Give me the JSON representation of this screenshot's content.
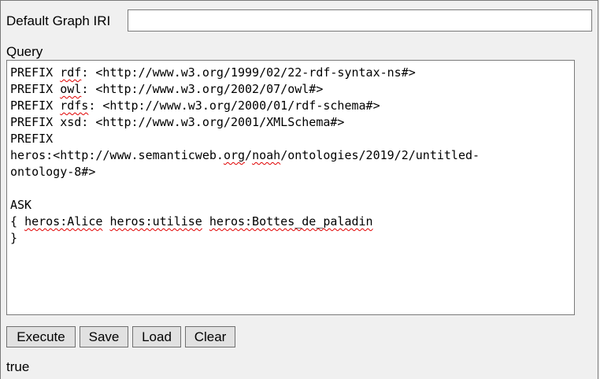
{
  "graph": {
    "label": "Default Graph IRI",
    "value": ""
  },
  "query": {
    "label": "Query",
    "lines": {
      "l1_pre": "PREFIX ",
      "l1_ns": "rdf",
      "l1_post": ": <http://www.w3.org/1999/02/22-rdf-syntax-ns#>",
      "l2_pre": "PREFIX ",
      "l2_ns": "owl",
      "l2_post": ": <http://www.w3.org/2002/07/owl#>",
      "l3_pre": "PREFIX ",
      "l3_ns": "rdfs",
      "l3_post": ": <http://www.w3.org/2000/01/rdf-schema#>",
      "l4": "PREFIX xsd: <http://www.w3.org/2001/XMLSchema#>",
      "l5": "PREFIX",
      "l6_a": "heros:<http://www.semanticweb.",
      "l6_b": "org",
      "l6_c": "/",
      "l6_d": "noah",
      "l6_e": "/ontologies/2019/2/untitled-",
      "l7": "ontology-8#>",
      "l8": "",
      "l9": "ASK",
      "l10_a": "{ ",
      "l10_b": "heros:Alice",
      "l10_c": " ",
      "l10_d": "heros:utilise",
      "l10_e": " ",
      "l10_f": "heros:Bottes_de_paladin",
      "l11": "}"
    }
  },
  "buttons": {
    "execute": "Execute",
    "save": "Save",
    "load": "Load",
    "clear": "Clear"
  },
  "result": {
    "text": "true"
  }
}
